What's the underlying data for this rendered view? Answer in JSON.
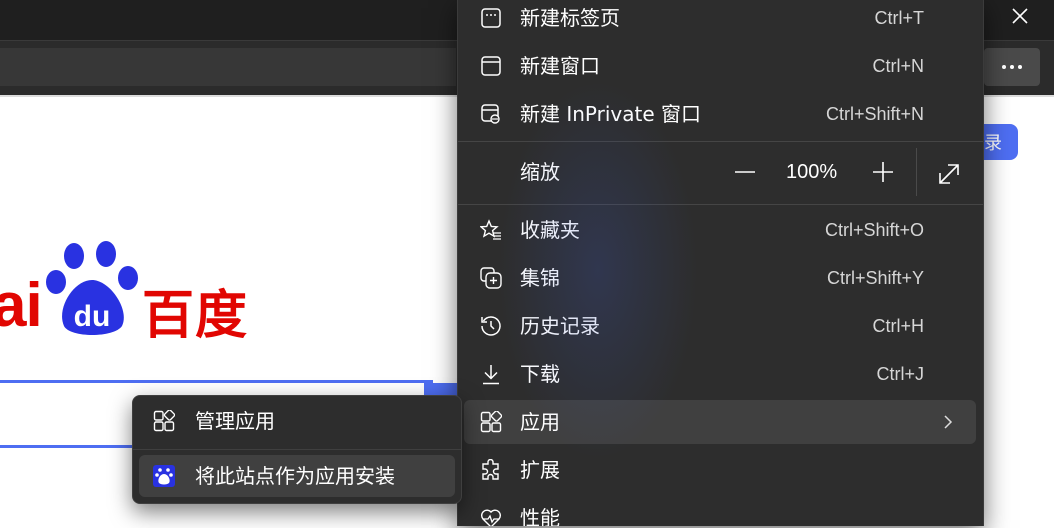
{
  "browser": {
    "close_icon": "close-icon",
    "more_icon": "more-horizontal-icon",
    "page_login_label": "录"
  },
  "page": {
    "logo_left_text": "ai",
    "logo_paw_text": "du",
    "logo_cn_text": "百度"
  },
  "menu": {
    "items_top": [
      {
        "label": "新建标签页",
        "shortcut": "Ctrl+T",
        "icon": "new-tab-icon"
      },
      {
        "label": "新建窗口",
        "shortcut": "Ctrl+N",
        "icon": "new-window-icon"
      },
      {
        "label": "新建 InPrivate 窗口",
        "shortcut": "Ctrl+Shift+N",
        "icon": "inprivate-window-icon"
      }
    ],
    "zoom": {
      "label": "缩放",
      "value": "100%",
      "minus_icon": "zoom-out-icon",
      "plus_icon": "zoom-in-icon",
      "fullscreen_icon": "fullscreen-icon"
    },
    "items_bottom": [
      {
        "label": "收藏夹",
        "shortcut": "Ctrl+Shift+O",
        "icon": "favorites-icon"
      },
      {
        "label": "集锦",
        "shortcut": "Ctrl+Shift+Y",
        "icon": "collections-icon"
      },
      {
        "label": "历史记录",
        "shortcut": "Ctrl+H",
        "icon": "history-icon"
      },
      {
        "label": "下载",
        "shortcut": "Ctrl+J",
        "icon": "download-icon"
      },
      {
        "label": "应用",
        "shortcut": "",
        "icon": "apps-icon"
      },
      {
        "label": "扩展",
        "shortcut": "",
        "icon": "extensions-icon"
      },
      {
        "label": "性能",
        "shortcut": "",
        "icon": "performance-icon"
      }
    ]
  },
  "submenu": {
    "items": [
      {
        "label": "管理应用",
        "icon": "apps-icon"
      },
      {
        "label": "将此站点作为应用安装",
        "icon": "baidu-site-icon"
      }
    ]
  },
  "colors": {
    "menu_bg": "#2d2d2d",
    "accent": "#4e6ef2",
    "baidu_red": "#e10602",
    "baidu_blue": "#2932e1"
  }
}
